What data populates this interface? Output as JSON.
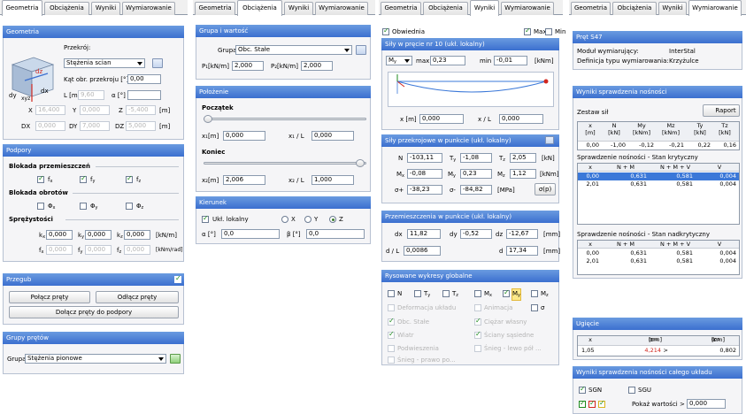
{
  "p1": {
    "tabs": [
      "Geometria",
      "Obciążenia",
      "Wyniki",
      "Wymiarowanie"
    ],
    "geometria_title": "Geometria",
    "przekroj_label": "Przekrój:",
    "przekroj_value": "Stężenia scian",
    "kat_label": "Kąt obr. przekroju [°]",
    "kat_value": "0,00",
    "L_label": "L [m]",
    "L_value": "9,60",
    "alpha_label": "α [°]",
    "alpha_value": "",
    "X_label": "X",
    "X_value": "16,400",
    "Y_label": "Y",
    "Y_value": "0,000",
    "Z_label": "Z",
    "Z_value": "-5,400",
    "m1": "[m]",
    "DX_label": "DX",
    "DX_value": "0,000",
    "DY_label": "DY",
    "DY_value": "7,000",
    "DZ_label": "DZ",
    "DZ_value": "5,000",
    "m2": "[m]",
    "cube_labels": {
      "dy": "dy",
      "dx": "dx",
      "dz": "dz",
      "xyz": "xyz"
    },
    "podpory_title": "Podpory",
    "blokada_przem": "Blokada przemieszczeń",
    "fx": "f",
    "fy": "f",
    "fz": "f",
    "sx": "x",
    "sy": "y",
    "sz": "z",
    "blokada_obrot": "Blokada obrotów",
    "phix": "Φ",
    "phiy": "Φ",
    "phiz": "Φ",
    "sprezystosci": "Sprężystości",
    "kx_label": "k",
    "kx_value": "0,000",
    "ky_label": "k",
    "ky_value": "0,000",
    "kz_label": "k",
    "kz_value": "0,000",
    "k_unit": "[kN/m]",
    "fxs_label": "f",
    "fxs_value": "0,000",
    "fys_label": "f",
    "fys_value": "0,000",
    "fzs_label": "f",
    "fzs_value": "0,000",
    "f_unit": "[kNm/rad]",
    "przegub_title": "Przegub",
    "polacz": "Połącz pręty",
    "odlacz": "Odłącz pręty",
    "dolacz": "Dołącz pręty do podpory",
    "grupy_title": "Grupy prętów",
    "grupa_label": "Grupa",
    "grupa_value": "Stężenia pionowe"
  },
  "p2": {
    "tabs": [
      "Geometria",
      "Obciążenia",
      "Wyniki",
      "Wymiarowanie"
    ],
    "gw_title": "Grupa i wartość",
    "grupa_label": "Grupa",
    "grupa_value": "Obc. Stałe",
    "P1_label": "P₁[kN/m]",
    "P1_value": "2,000",
    "P2_label": "P₂[kN/m]",
    "P2_value": "2,000",
    "pol_title": "Położenie",
    "poczatek": "Początek",
    "x1_label": "x₁[m]",
    "x1_value": "0,000",
    "x1L_label": "x₁ / L",
    "x1L_value": "0,000",
    "koniec": "Koniec",
    "x2_label": "x₂[m]",
    "x2_value": "2,006",
    "x2L_label": "x₂ / L",
    "x2L_value": "1,000",
    "kier_title": "Kierunek",
    "ukl_lok": "Ukł. lokalny",
    "rx": "X",
    "ry": "Y",
    "rz": "Z",
    "alpha_label": "α [°]",
    "alpha_value": "0,0",
    "beta_label": "β [°]",
    "beta_value": "0,0"
  },
  "p3": {
    "tabs": [
      "Geometria",
      "Obciążenia",
      "Wyniki",
      "Wymiarowanie"
    ],
    "obwiednia": "Obwiednia",
    "max": "Max",
    "min": "Min",
    "sily_title": "Siły w pręcie nr 10 (ukł. lokalny)",
    "My_sel": "M",
    "My_sub": "y",
    "max_label": "max",
    "max_value": "0,23",
    "min_label": "min",
    "min_value": "-0,01",
    "unit_knm": "[kNm]",
    "x_label": "x [m]",
    "x_value": "0,000",
    "xL_label": "x / L",
    "xL_value": "0,000",
    "sp_title": "Siły przekrojowe w punkcie (ukł. lokalny)",
    "N_label": "N",
    "N_value": "-103,11",
    "Ty_label": "T",
    "Ty_value": "-1,08",
    "Tz_label": "T",
    "Tz_value": "2,05",
    "u_kn1": "[kN]",
    "Mx_label": "M",
    "Mx_value": "-0,08",
    "My_label": "M",
    "My_value": "0,23",
    "Mz_label": "M",
    "Mz_value": "1,12",
    "u_knm": "[kNm]",
    "sp_label": "σ+",
    "sp_value": "-38,23",
    "sm_label": "σ-",
    "sm_value": "-84,82",
    "u_mpa": "[MPa]",
    "sigma_btn": "σ(p)",
    "pp_title": "Przemieszczenia w punkcie (ukł. lokalny)",
    "dx_label": "dx",
    "dx_value": "11,82",
    "dy_label": "dy",
    "dy_value": "-0,52",
    "dz_label": "dz",
    "dz_value": "-12,67",
    "u_mm1": "[mm]",
    "dL_label": "d / L",
    "dL_value": "0,0086",
    "d_label": "d",
    "d_value": "17,34",
    "u_mm2": "[mm]",
    "rw_title": "Rysowane wykresy globalne",
    "w_N": "N",
    "w_Ty": "T",
    "w_Tz": "T",
    "w_Mx": "M",
    "w_My": "M",
    "w_Mz": "M",
    "deformacja": "Deformacja układu",
    "animacja": "Animacja",
    "sigma": "σ",
    "obc_stale": "Obc. Stałe",
    "ciezar": "Ciężar własny",
    "wiatr": "Wiatr",
    "sciany": "Ściany sąsiedne",
    "podwieszenia": "Podwieszenia",
    "snieg_lewo": "Śnieg - lewo pół ...",
    "snieg_prawo": "Śnieg - prawo po..."
  },
  "p4": {
    "tabs": [
      "Geometria",
      "Obciążenia",
      "Wyniki",
      "Wymiarowanie"
    ],
    "pret_title": "Pręt S47",
    "modul_label": "Moduł wymiarujący:",
    "modul_value": "InterStal",
    "def_label": "Definicja typu wymiarowania:",
    "def_value": "Krzyżulce",
    "wsn_title": "Wyniki sprawdzenia nośności",
    "zestaw": "Zestaw sił",
    "raport": "Raport",
    "zh": [
      "x\n[m]",
      "N\n[kN]",
      "My\n[kNm]",
      "Mz\n[kNm]",
      "Ty\n[kN]",
      "Tz\n[kN]"
    ],
    "zrow": [
      "0,00",
      "-1,00",
      "-0,12",
      "-0,21",
      "0,22",
      "0,16"
    ],
    "kryt_label": "Sprawdzenie nośności - Stan krytyczny",
    "kh": [
      "x",
      "N + M",
      "N + M + V",
      "V"
    ],
    "krows": [
      [
        "0,00",
        "0,631",
        "0,581",
        "0,004"
      ],
      [
        "2,01",
        "0,631",
        "0,581",
        "0,004"
      ]
    ],
    "nadk_label": "Sprawdzenie nośności - Stan nadkrytyczny",
    "nrows": [
      [
        "0,00",
        "0,631",
        "0,581",
        "0,004"
      ],
      [
        "2,01",
        "0,631",
        "0,581",
        "0,004"
      ]
    ],
    "ug_title": "Ugięcie",
    "uh": [
      "x",
      "u",
      "max",
      "[cm]",
      "u",
      "dop",
      "[cm]"
    ],
    "urow": [
      "1,05",
      "4,214",
      ">",
      "0,802"
    ],
    "wsc_title": "Wyniki sprawdzenia nośności całego układu",
    "sgn": "SGN",
    "sgu": "SGU",
    "pokaz_label": "Pokaż wartości >",
    "pokaz_value": "0,000"
  },
  "colors": {
    "title_bar": "#3b6fcf",
    "selected": "#3b78d8",
    "red": "#d2261e",
    "green": "#1d8a1d"
  }
}
